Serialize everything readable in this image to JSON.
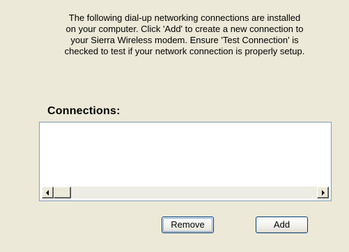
{
  "instructions": {
    "line1": "The following dial-up networking connections are installed",
    "line2": "on your computer. Click 'Add' to create a new connection to",
    "line3": "your Sierra Wireless modem. Ensure 'Test Connection' is",
    "line4": "checked to test if your network connection is properly setup."
  },
  "connections": {
    "label": "Connections:",
    "items": []
  },
  "buttons": {
    "remove_label": "Remove",
    "add_label": "Add"
  },
  "colors": {
    "dialog_background": "#ece9d8",
    "list_border": "#7f9db9",
    "button_border": "#003c74"
  }
}
